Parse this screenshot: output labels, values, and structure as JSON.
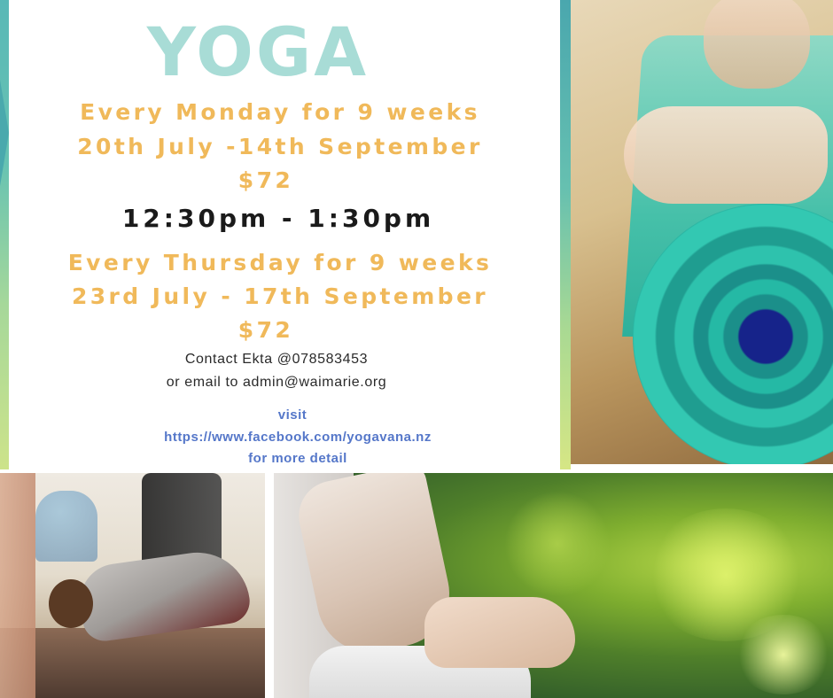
{
  "title": "YOGA",
  "session1": {
    "line1": "Every Monday for 9 weeks",
    "line2": "20th July -14th September",
    "price": "$72"
  },
  "time": "12:30pm - 1:30pm",
  "session2": {
    "line1": "Every Thursday for 9 weeks",
    "line2": "23rd July - 17th September",
    "price": "$72"
  },
  "contact": {
    "phone_line": "Contact Ekta @078583453",
    "email_line": "or email to admin@waimarie.org"
  },
  "visit": {
    "label": "visit",
    "url": "https://www.facebook.com/yogavana.nz",
    "suffix": "for more detail"
  },
  "colors": {
    "title": "#a8dcd6",
    "gold": "#f0b95a",
    "link": "#5577c9",
    "accent_stripe": "#59b8b7"
  },
  "images": {
    "top_right": "rolled-yoga-mat-photo",
    "bottom_left": "yoga-class-photo",
    "bottom_right": "meditation-hand-photo"
  }
}
